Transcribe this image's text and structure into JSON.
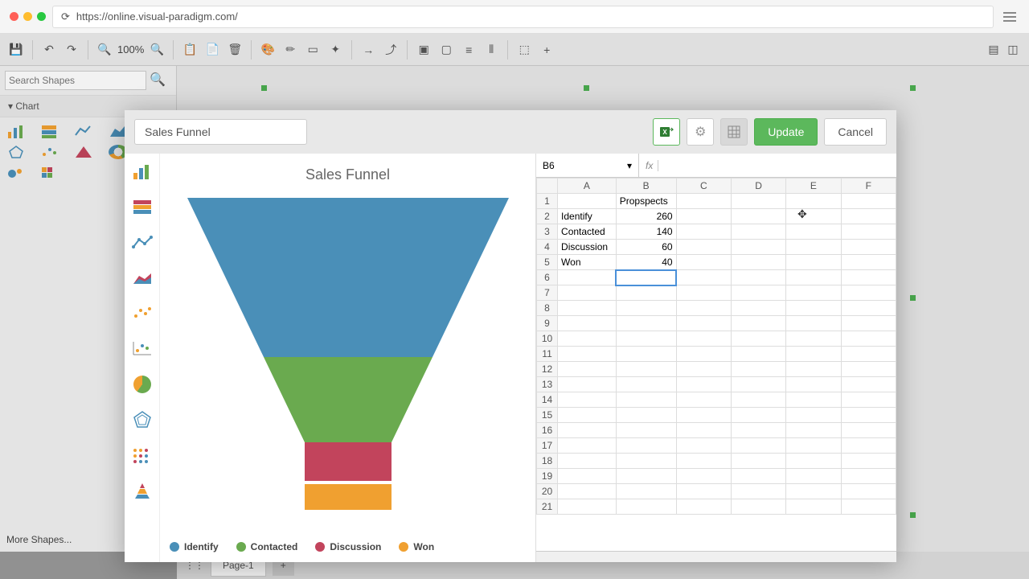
{
  "browser": {
    "url": "https://online.visual-paradigm.com/",
    "dots": [
      "#ff5f57",
      "#febc2e",
      "#28c840"
    ]
  },
  "toolbar": {
    "zoom": "100%"
  },
  "sidebar": {
    "search_ph": "Search Shapes",
    "section": "Chart",
    "more": "More Shapes..."
  },
  "pagebar": {
    "page": "Page-1"
  },
  "modal": {
    "title": "Sales Funnel",
    "buttons": {
      "update": "Update",
      "cancel": "Cancel"
    }
  },
  "chart": {
    "title": "Sales Funnel"
  },
  "legend": [
    "Identify",
    "Contacted",
    "Discussion",
    "Won"
  ],
  "colors": {
    "identify": "#4a8fb8",
    "contacted": "#6aaa4f",
    "discussion": "#c2445c",
    "won": "#f0a030"
  },
  "sheet": {
    "cellref": "B6",
    "cols": [
      "A",
      "B",
      "C",
      "D",
      "E",
      "F"
    ],
    "rows": 21,
    "data": {
      "1": {
        "B": "Propspects"
      },
      "2": {
        "A": "Identify",
        "B": "260"
      },
      "3": {
        "A": "Contacted",
        "B": "140"
      },
      "4": {
        "A": "Discussion",
        "B": "60"
      },
      "5": {
        "A": "Won",
        "B": "40"
      }
    },
    "selected": "B6"
  },
  "chart_data": {
    "type": "funnel",
    "title": "Sales Funnel",
    "series_name": "Propspects",
    "categories": [
      "Identify",
      "Contacted",
      "Discussion",
      "Won"
    ],
    "values": [
      260,
      140,
      60,
      40
    ],
    "colors": [
      "#4a8fb8",
      "#6aaa4f",
      "#c2445c",
      "#f0a030"
    ]
  }
}
